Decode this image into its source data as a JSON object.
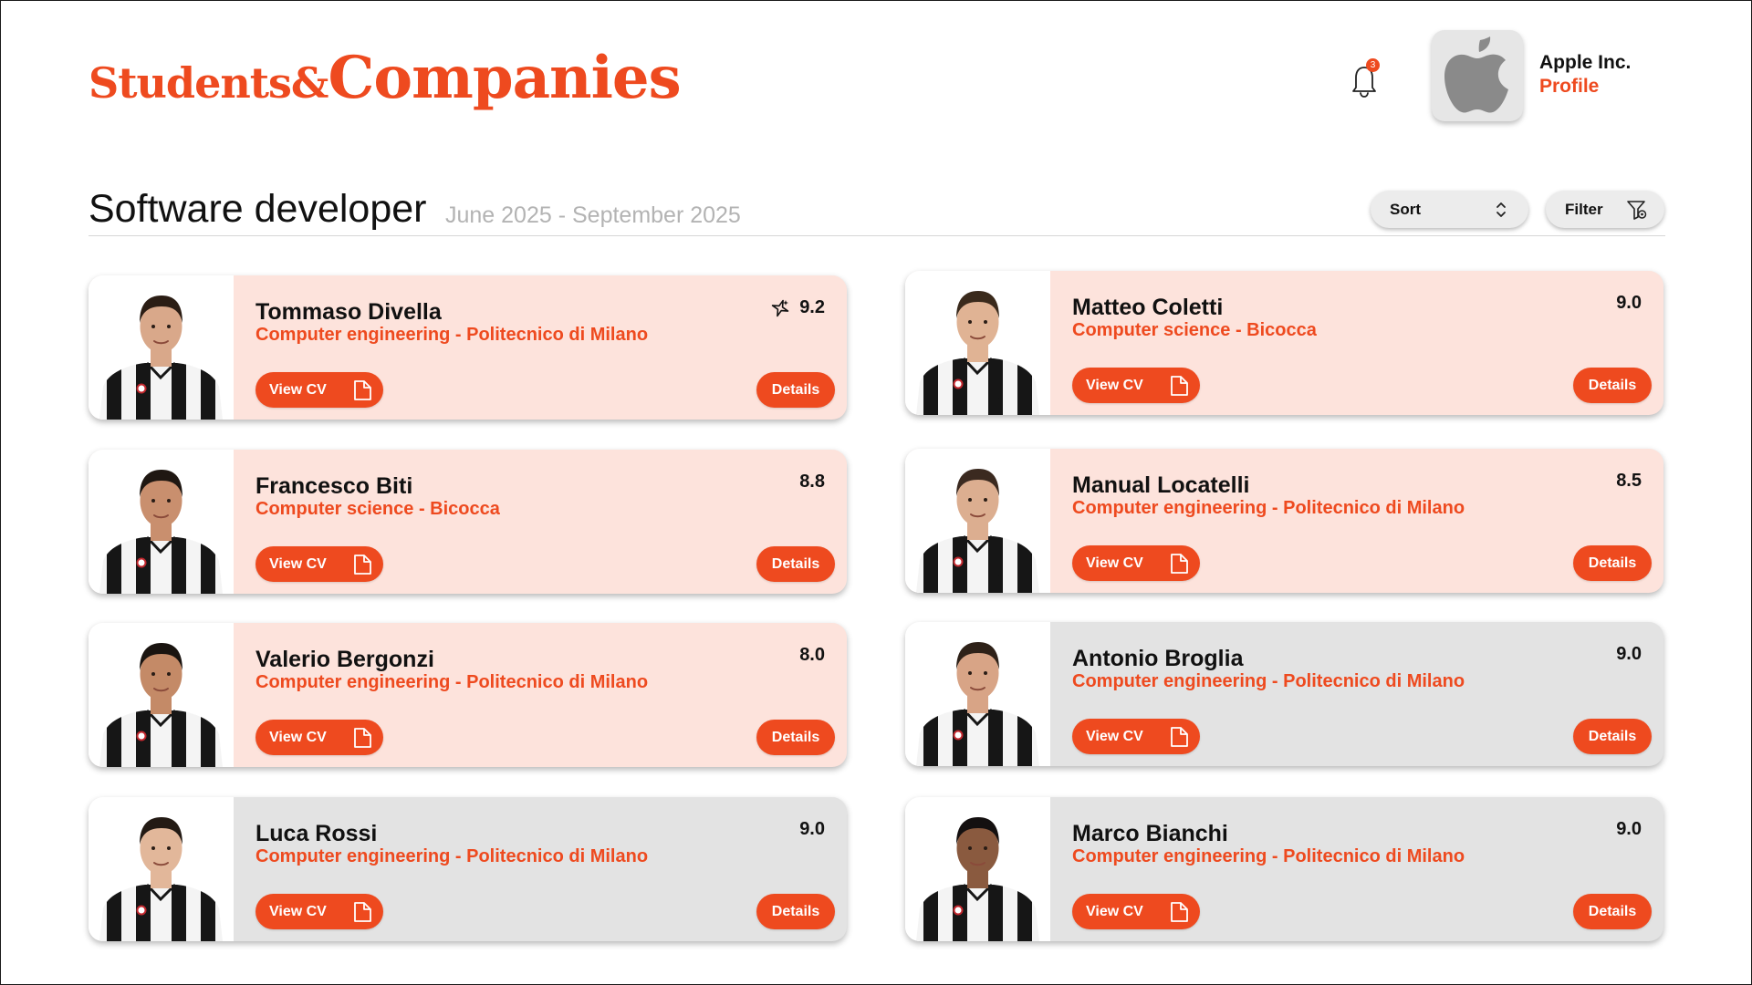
{
  "brand": {
    "part1": "Students&",
    "part2": "Companies",
    "accent_color": "#ee4a1f"
  },
  "notifications": {
    "count": "3",
    "icon": "bell-icon"
  },
  "company": {
    "name": "Apple Inc.",
    "profile_label": "Profile",
    "logo_icon": "apple-logo-icon"
  },
  "position": {
    "title": "Software developer",
    "dates": "June 2025 - September 2025"
  },
  "controls": {
    "sort_label": "Sort",
    "filter_label": "Filter"
  },
  "candidates": [
    {
      "name": "Tommaso Divella",
      "school": "Computer engineering - Politecnico di Milano",
      "score": "9.2",
      "highlighted": true,
      "ai_pick": true,
      "view_cv": "View CV",
      "details": "Details"
    },
    {
      "name": "Matteo Coletti",
      "school": "Computer science - Bicocca",
      "score": "9.0",
      "highlighted": true,
      "ai_pick": false,
      "view_cv": "View CV",
      "details": "Details"
    },
    {
      "name": "Francesco Biti",
      "school": "Computer science - Bicocca",
      "score": "8.8",
      "highlighted": true,
      "ai_pick": false,
      "view_cv": "View CV",
      "details": "Details"
    },
    {
      "name": "Manual Locatelli",
      "school": "Computer engineering - Politecnico di Milano",
      "score": "8.5",
      "highlighted": true,
      "ai_pick": false,
      "view_cv": "View CV",
      "details": "Details"
    },
    {
      "name": "Valerio Bergonzi",
      "school": "Computer engineering - Politecnico di Milano",
      "score": "8.0",
      "highlighted": true,
      "ai_pick": false,
      "view_cv": "View CV",
      "details": "Details"
    },
    {
      "name": "Antonio Broglia",
      "school": "Computer engineering - Politecnico di Milano",
      "score": "9.0",
      "highlighted": false,
      "ai_pick": false,
      "view_cv": "View CV",
      "details": "Details"
    },
    {
      "name": "Luca Rossi",
      "school": "Computer engineering - Politecnico di Milano",
      "score": "9.0",
      "highlighted": false,
      "ai_pick": false,
      "view_cv": "View CV",
      "details": "Details"
    },
    {
      "name": "Marco Bianchi",
      "school": "Computer engineering - Politecnico di Milano",
      "score": "9.0",
      "highlighted": false,
      "ai_pick": false,
      "view_cv": "View CV",
      "details": "Details"
    }
  ]
}
